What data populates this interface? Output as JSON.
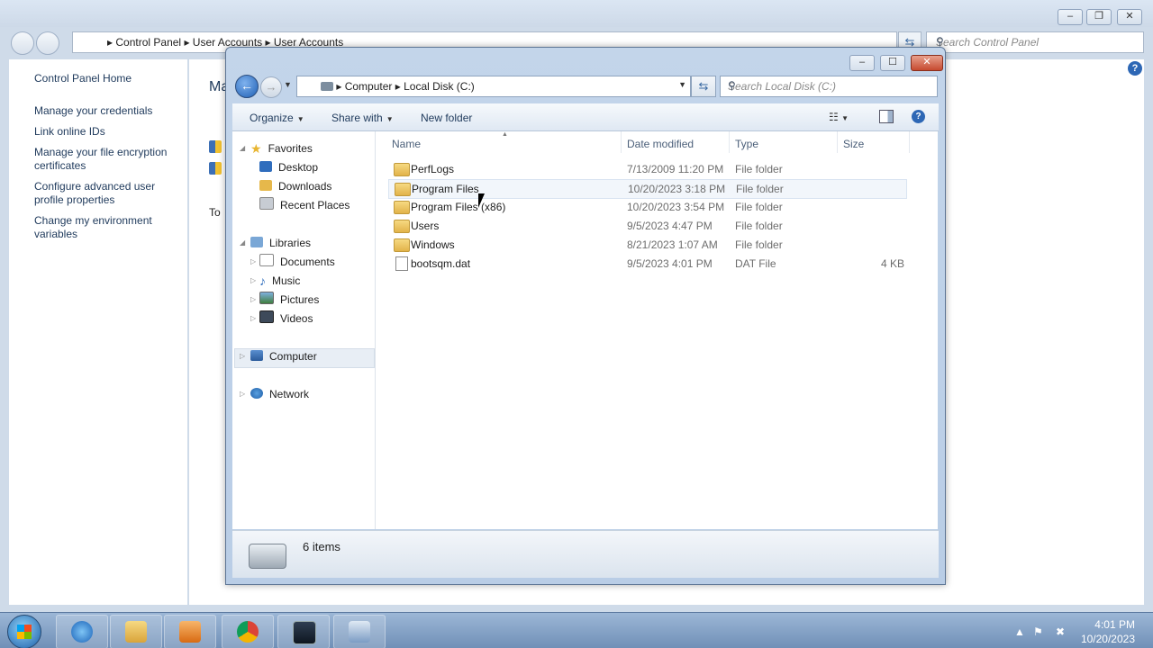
{
  "background_window": {
    "breadcrumbs": [
      "Control Panel",
      "User Accounts",
      "User Accounts"
    ],
    "search_placeholder": "Search Control Panel",
    "left_links": [
      "Control Panel Home",
      "Manage your credentials",
      "Link online IDs",
      "Manage your file encryption certificates",
      "Configure advanced user profile properties",
      "Change my environment variables"
    ],
    "main_partial_title": "Ma",
    "main_partial_text": "To"
  },
  "explorer": {
    "breadcrumbs": [
      "Computer",
      "Local Disk (C:)"
    ],
    "search_placeholder": "Search Local Disk (C:)",
    "toolbar": {
      "organize": "Organize",
      "share_with": "Share with",
      "new_folder": "New folder"
    },
    "nav": {
      "favorites": "Favorites",
      "desktop": "Desktop",
      "downloads": "Downloads",
      "recent_places": "Recent Places",
      "libraries": "Libraries",
      "documents": "Documents",
      "music": "Music",
      "pictures": "Pictures",
      "videos": "Videos",
      "computer": "Computer",
      "network": "Network"
    },
    "columns": {
      "name": "Name",
      "date_modified": "Date modified",
      "type": "Type",
      "size": "Size"
    },
    "files": [
      {
        "name": "PerfLogs",
        "date": "7/13/2009 11:20 PM",
        "type": "File folder",
        "size": ""
      },
      {
        "name": "Program Files",
        "date": "10/20/2023 3:18 PM",
        "type": "File folder",
        "size": ""
      },
      {
        "name": "Program Files (x86)",
        "date": "10/20/2023 3:54 PM",
        "type": "File folder",
        "size": ""
      },
      {
        "name": "Users",
        "date": "9/5/2023 4:47 PM",
        "type": "File folder",
        "size": ""
      },
      {
        "name": "Windows",
        "date": "8/21/2023 1:07 AM",
        "type": "File folder",
        "size": ""
      },
      {
        "name": "bootsqm.dat",
        "date": "9/5/2023 4:01 PM",
        "type": "DAT File",
        "size": "4 KB"
      }
    ],
    "status": "6 items"
  },
  "taskbar": {
    "time": "4:01 PM",
    "date": "10/20/2023"
  },
  "colors": {
    "link": "#1e395b",
    "taskbar": "#7f9fc4",
    "window_frame": "#bfd2e8"
  }
}
